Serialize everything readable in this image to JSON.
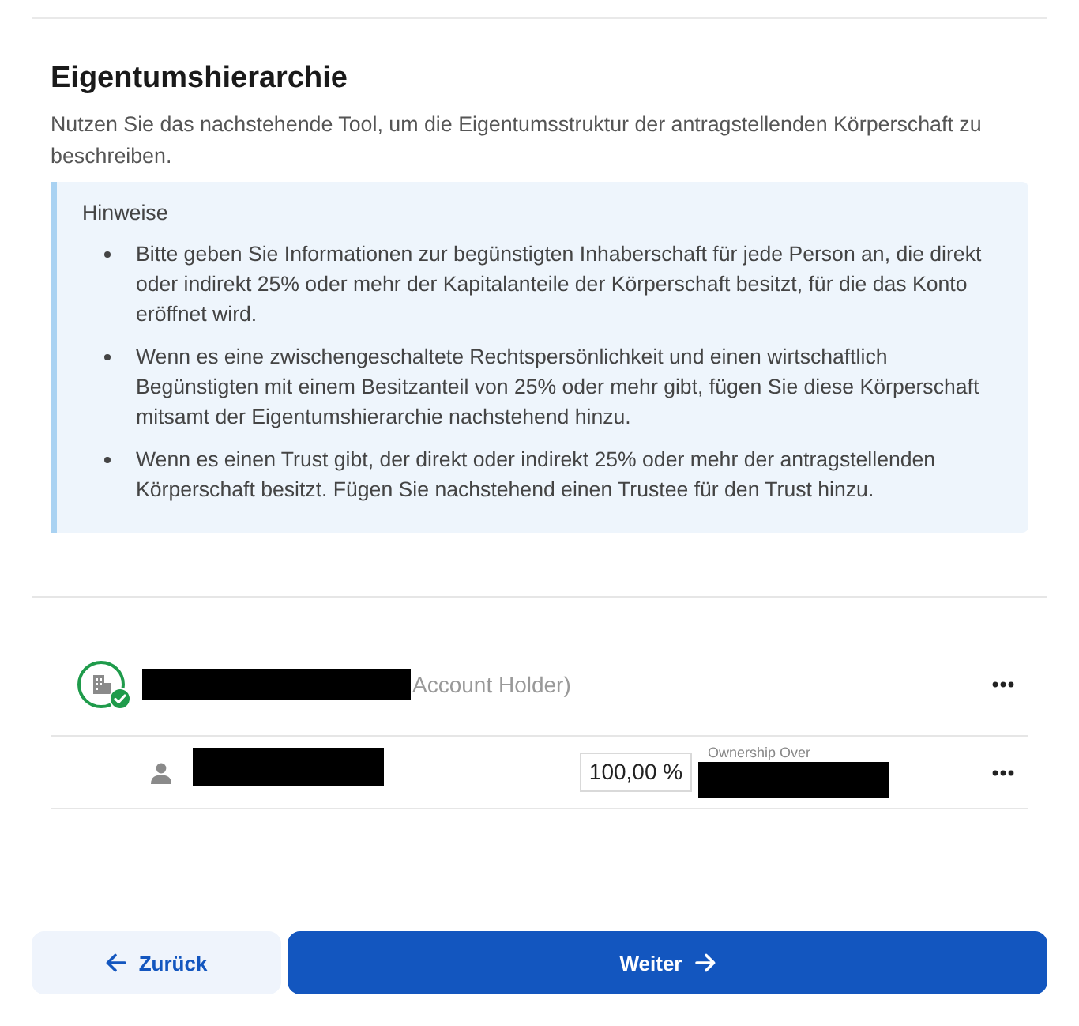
{
  "section": {
    "title": "Eigentumshierarchie",
    "description": "Nutzen Sie das nachstehende Tool, um die Eigentumsstruktur der antragstellenden Körperschaft zu beschreiben."
  },
  "notes": {
    "title": "Hinweise",
    "items": [
      "Bitte geben Sie Informationen zur begünstigten Inhaberschaft für jede Person an, die direkt oder indirekt 25% oder mehr der Kapitalanteile der Körperschaft besitzt, für die das Konto eröffnet wird.",
      "Wenn es eine zwischengeschaltete Rechtspersönlichkeit und einen wirtschaftlich Begünstigten mit einem Besitzanteil von 25% oder mehr gibt, fügen Sie diese Körperschaft mitsamt der Eigentumshierarchie nachstehend hinzu.",
      "Wenn es einen Trust gibt, der direkt oder indirekt 25% oder mehr der antragstellenden Körperschaft besitzt. Fügen Sie nachstehend einen Trustee für den Trust hinzu."
    ]
  },
  "owners": [
    {
      "kind": "entity",
      "verified": true,
      "name_suffix": "Account Holder)"
    },
    {
      "kind": "person",
      "ownership": "100,00 %",
      "ownership_label": "Ownership Over"
    }
  ],
  "buttons": [
    {
      "kind": "back",
      "label": "Zurück"
    },
    {
      "kind": "next",
      "label": "Weiter"
    }
  ]
}
